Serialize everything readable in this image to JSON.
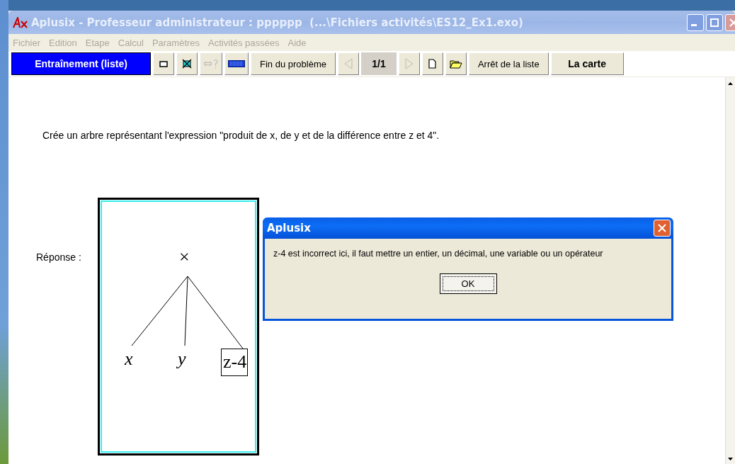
{
  "window": {
    "title": "Aplusix - Professeur administrateur : pppppp  (...\\Fichiers activités\\ES12_Ex1.exo)"
  },
  "menu": [
    {
      "label": "Fichier",
      "disabled": true
    },
    {
      "label": "Edition",
      "disabled": true
    },
    {
      "label": "Etape",
      "disabled": true
    },
    {
      "label": "Calcul",
      "disabled": true
    },
    {
      "label": "Paramètres",
      "disabled": true
    },
    {
      "label": "Activités passées",
      "disabled": true
    },
    {
      "label": "Aide",
      "disabled": true
    }
  ],
  "toolbar": {
    "mode": "Entraînement (liste)",
    "compare_disabled": true,
    "finish": "Fin du problème",
    "prev_disabled": true,
    "counter": "1/1",
    "next_disabled": true,
    "stop_list": "Arrêt de la liste",
    "map": "La carte"
  },
  "question": "Crée un arbre représentant l'expression \"produit de x, de y et de la différence entre z et 4\".",
  "answer_label": "Réponse :",
  "tree": {
    "label": "×",
    "children": [
      {
        "label": "x",
        "kind": "variable",
        "boxed": false
      },
      {
        "label": "y",
        "kind": "variable",
        "boxed": false
      },
      {
        "label": "z-4",
        "kind": "expression",
        "boxed": true
      }
    ]
  },
  "dialog": {
    "title": "Aplusix",
    "message": "z-4 est incorrect ici, il faut mettre un entier, un décimal, une variable ou un opérateur",
    "ok": "OK"
  }
}
